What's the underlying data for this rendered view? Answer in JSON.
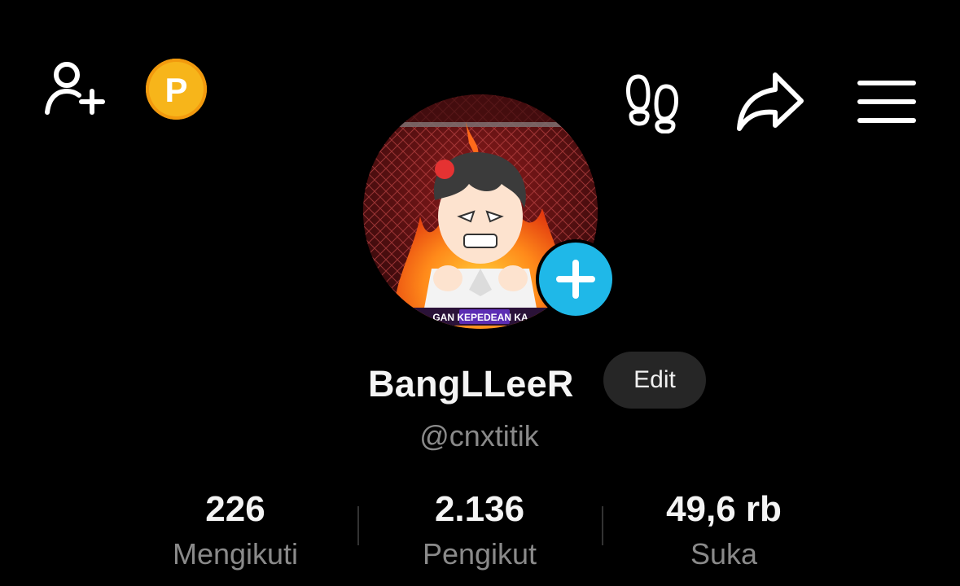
{
  "topbar": {
    "left_icons": [
      "add-friend-icon",
      "coin-icon"
    ],
    "coin_letter": "P",
    "right_icons": [
      "footprints-icon",
      "share-icon",
      "menu-icon"
    ]
  },
  "profile": {
    "avatar_caption": "GAN KEPEDEAN KA",
    "avatar_add_icon": "plus-icon",
    "username": "BangLLeeR",
    "edit_label": "Edit",
    "handle": "@cnxtitik"
  },
  "stats": [
    {
      "value": "226",
      "label": "Mengikuti"
    },
    {
      "value": "2.136",
      "label": "Pengikut"
    },
    {
      "value": "49,6 rb",
      "label": "Suka"
    }
  ],
  "colors": {
    "background": "#000000",
    "coin": "#f7b51a",
    "avatar_add": "#1fb8e8",
    "secondary_text": "#8a8a8a",
    "edit_button": "#262626"
  }
}
